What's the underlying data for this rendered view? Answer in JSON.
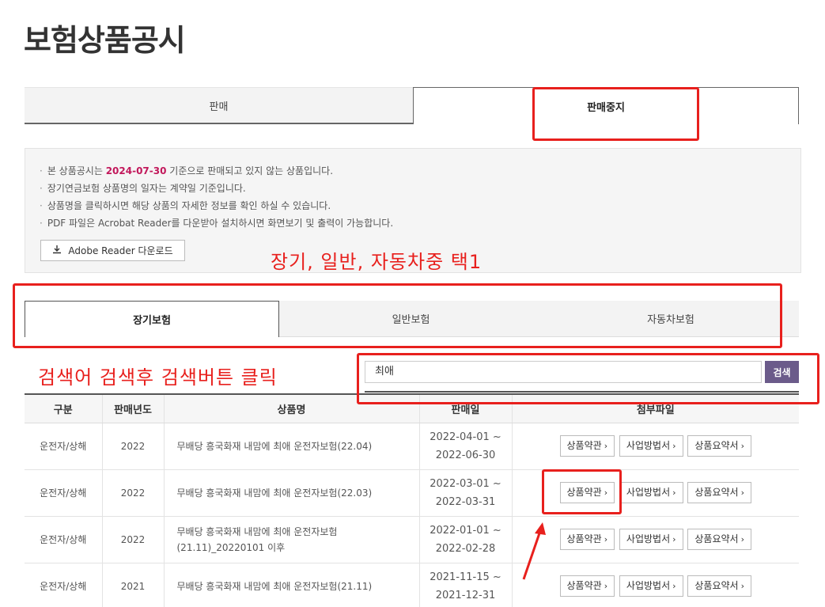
{
  "page_title": "보험상품공시",
  "main_tabs": [
    {
      "label": "판매",
      "active": false
    },
    {
      "label": "판매중지",
      "active": true
    }
  ],
  "info": {
    "line1_pre": "본 상품공시는 ",
    "line1_date": "2024-07-30",
    "line1_post": " 기준으로 판매되고 있지 않는 상품입니다.",
    "line2": "장기연금보험 상품명의 일자는 계약일 기준입니다.",
    "line3": "상품명을 클릭하시면 해당 상품의 자세한 정보를 확인 하실 수 있습니다.",
    "line4": "PDF 파일은 Acrobat Reader를 다운받아 설치하시면 화면보기 및 출력이 가능합니다.",
    "adobe_button": "Adobe Reader 다운로드"
  },
  "annotations": {
    "tab_note": "장기, 일반, 자동차중 택1",
    "search_note": "검색어 검색후 검색버튼 클릭"
  },
  "sub_tabs": [
    {
      "label": "장기보험",
      "active": true
    },
    {
      "label": "일반보험",
      "active": false
    },
    {
      "label": "자동차보험",
      "active": false
    }
  ],
  "search": {
    "value": "최애",
    "button": "검색"
  },
  "table": {
    "headers": [
      "구분",
      "판매년도",
      "상품명",
      "판매일",
      "첨부파일"
    ],
    "rows": [
      {
        "category": "운전자/상해",
        "year": "2022",
        "name": "무배당 흥국화재 내맘에 최애 운전자보험(22.04)",
        "start": "2022-04-01 ~",
        "end": "2022-06-30"
      },
      {
        "category": "운전자/상해",
        "year": "2022",
        "name": "무배당 흥국화재 내맘에 최애 운전자보험(22.03)",
        "start": "2022-03-01 ~",
        "end": "2022-03-31"
      },
      {
        "category": "운전자/상해",
        "year": "2022",
        "name": "무배당 흥국화재 내맘에 최애 운전자보험(21.11)_20220101 이후",
        "start": "2022-01-01 ~",
        "end": "2022-02-28"
      },
      {
        "category": "운전자/상해",
        "year": "2021",
        "name": "무배당 흥국화재 내맘에 최애 운전자보험(21.11)",
        "start": "2021-11-15 ~",
        "end": "2021-12-31"
      }
    ],
    "doc_buttons": [
      "상품약관",
      "사업방법서",
      "상품요약서"
    ]
  }
}
